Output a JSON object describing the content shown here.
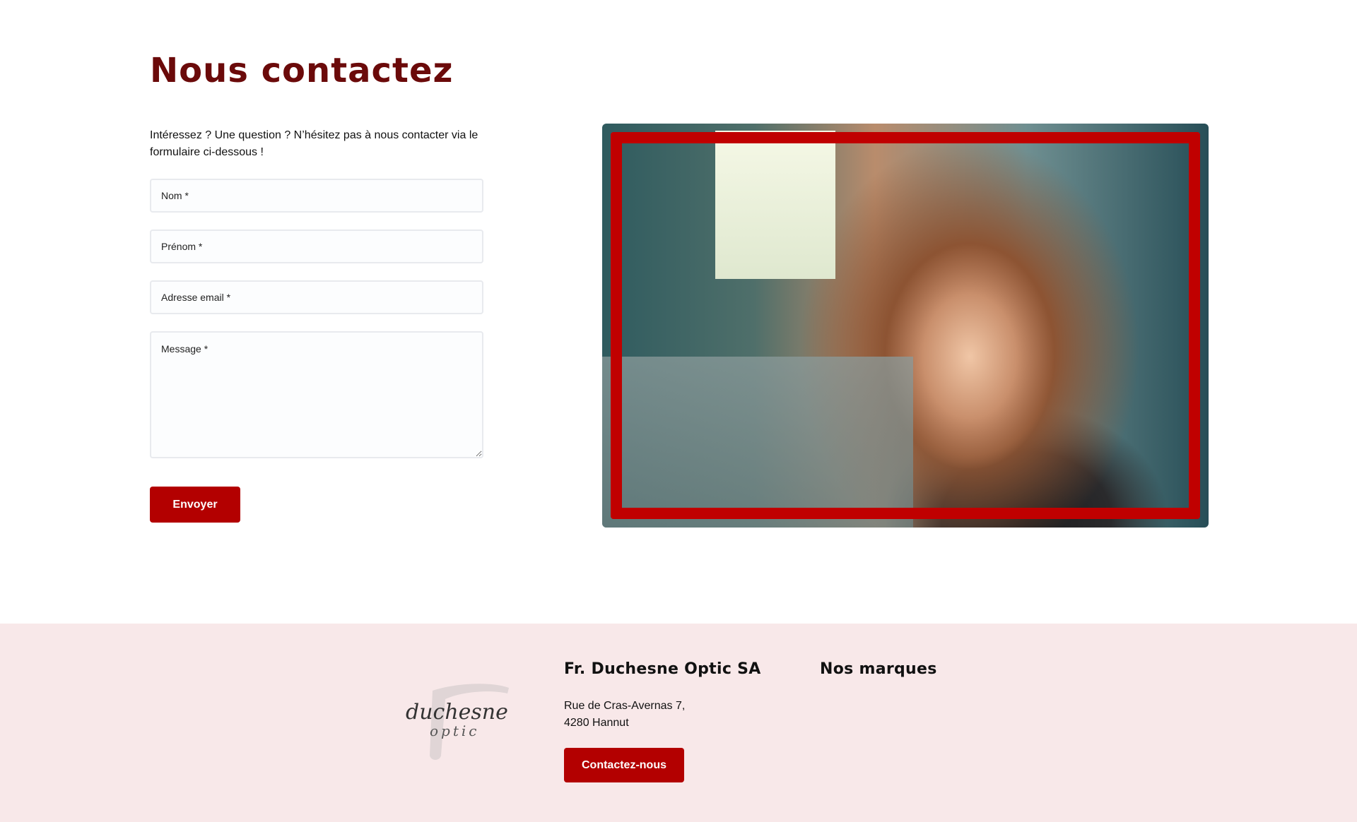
{
  "contact": {
    "title": "Nous contactez",
    "intro": "Intéressez ? Une question ? N’hésitez pas à nous contacter via le formulaire ci-dessous !",
    "fields": {
      "nom_placeholder": "Nom *",
      "prenom_placeholder": "Prénom *",
      "email_placeholder": "Adresse email *",
      "message_placeholder": "Message *"
    },
    "submit_label": "Envoyer"
  },
  "footer": {
    "company_title": "Fr. Duchesne Optic SA",
    "address_line1": "Rue de Cras-Avernas 7,",
    "address_line2": "4280 Hannut",
    "contact_button": "Contactez-nous",
    "brands_title": "Nos marques",
    "logo": {
      "line1": "duchesne",
      "line2": "optic"
    }
  },
  "colors": {
    "title": "#6b0a0a",
    "accent": "#b30000",
    "frame": "#c00000",
    "footer_bg": "#f8e8e9"
  }
}
